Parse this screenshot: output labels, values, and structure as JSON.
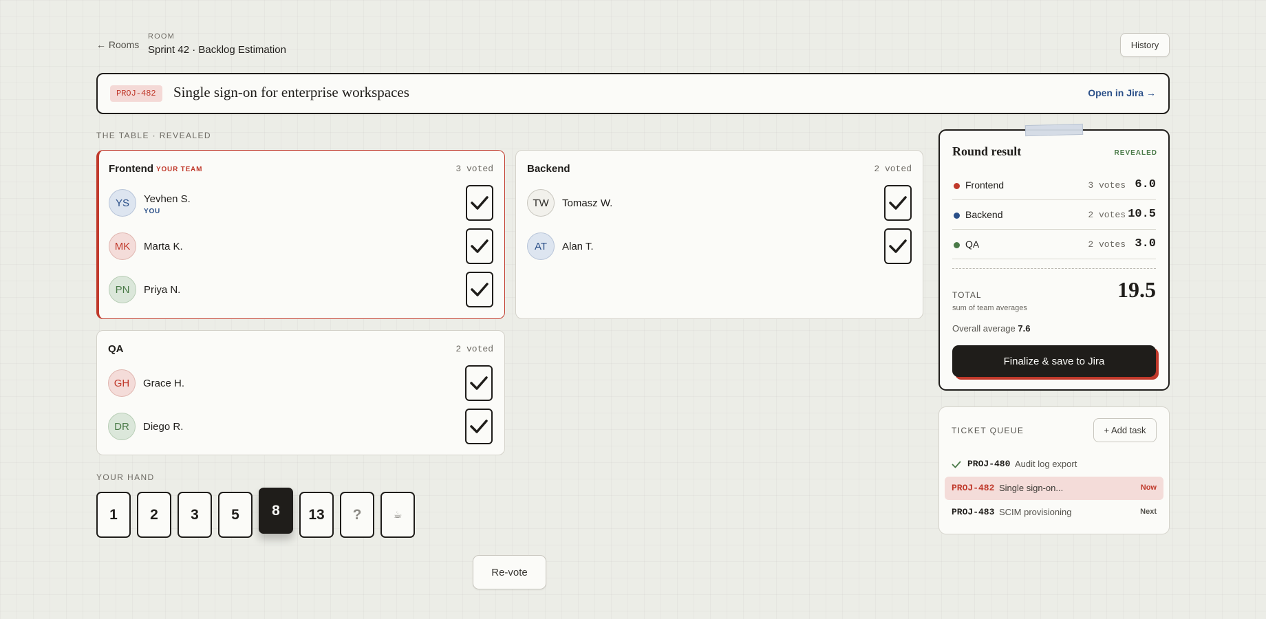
{
  "header": {
    "back_label": "← Rooms",
    "room_label": "ROOM",
    "room_title": "Sprint 42 · Backlog Estimation",
    "history_label": "History"
  },
  "ticket": {
    "id": "PROJ-482",
    "title": "Single sign-on for enterprise workspaces",
    "link_label": "Open in Jira →"
  },
  "table_label": "THE TABLE · REVEALED",
  "teams": [
    {
      "name": "Frontend",
      "tag": "YOUR TEAM",
      "voted": "3 voted",
      "members": [
        {
          "initials": "YS",
          "name": "Yevhen S.",
          "you": "YOU",
          "color": "blue"
        },
        {
          "initials": "MK",
          "name": "Marta K.",
          "color": "red"
        },
        {
          "initials": "PN",
          "name": "Priya N.",
          "color": "green"
        }
      ]
    },
    {
      "name": "Backend",
      "voted": "2 voted",
      "members": [
        {
          "initials": "TW",
          "name": "Tomasz W.",
          "color": "grey"
        },
        {
          "initials": "AT",
          "name": "Alan T.",
          "color": "blue"
        }
      ]
    },
    {
      "name": "QA",
      "voted": "2 voted",
      "members": [
        {
          "initials": "GH",
          "name": "Grace H.",
          "color": "red"
        },
        {
          "initials": "DR",
          "name": "Diego R.",
          "color": "green"
        }
      ]
    }
  ],
  "hand": {
    "label": "YOUR HAND",
    "cards": [
      "1",
      "2",
      "3",
      "5",
      "8",
      "13",
      "?",
      "☕"
    ],
    "selected": "8"
  },
  "revote_label": "Re-vote",
  "result": {
    "title": "Round result",
    "badge": "REVEALED",
    "rows": [
      {
        "team": "Frontend",
        "votes": "3 votes",
        "avg": "6.0",
        "color": "#c0392b"
      },
      {
        "team": "Backend",
        "votes": "2 votes",
        "avg": "10.5",
        "color": "#2a4f88"
      },
      {
        "team": "QA",
        "votes": "2 votes",
        "avg": "3.0",
        "color": "#4a7a48"
      }
    ],
    "total_label": "TOTAL",
    "total_sub": "sum of team averages",
    "total_value": "19.5",
    "overall_label": "Overall average",
    "overall_value": "7.6",
    "finalize_label": "Finalize & save to Jira"
  },
  "queue": {
    "label": "TICKET QUEUE",
    "add_label": "+ Add task",
    "items": [
      {
        "id": "PROJ-480",
        "title": "Audit log export",
        "status": "done",
        "status_label": ""
      },
      {
        "id": "PROJ-482",
        "title": "Single sign-on...",
        "status": "now",
        "status_label": "Now"
      },
      {
        "id": "PROJ-483",
        "title": "SCIM provisioning",
        "status": "next",
        "status_label": "Next"
      }
    ]
  },
  "colors": {
    "accent": "#c0392b",
    "ink": "#1f1d1a",
    "blue": "#2a4f88",
    "green": "#4a7a48",
    "background": "#ecede7"
  }
}
